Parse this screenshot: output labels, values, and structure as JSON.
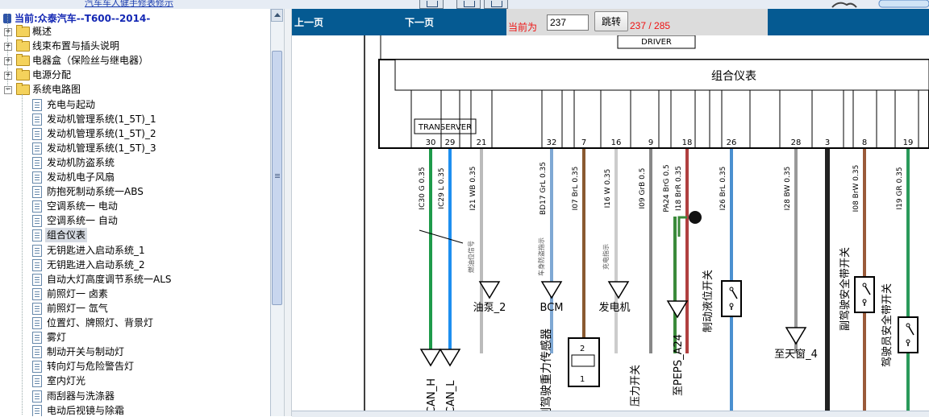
{
  "top": {
    "link_text": "汽车车人健手修表修示"
  },
  "tree": {
    "title": "当前:众泰汽车--T600--2014-",
    "nodes": [
      {
        "label": "概述",
        "kind": "folder",
        "expanded": false
      },
      {
        "label": "线束布置与插头说明",
        "kind": "folder",
        "expanded": false
      },
      {
        "label": "电器盒（保险丝与继电器）",
        "kind": "folder",
        "expanded": false
      },
      {
        "label": "电源分配",
        "kind": "folder",
        "expanded": false
      },
      {
        "label": "系统电路图",
        "kind": "folder",
        "expanded": true
      },
      {
        "label": "充电与起动",
        "kind": "doc"
      },
      {
        "label": "发动机管理系统(1_5T)_1",
        "kind": "doc"
      },
      {
        "label": "发动机管理系统(1_5T)_2",
        "kind": "doc"
      },
      {
        "label": "发动机管理系统(1_5T)_3",
        "kind": "doc"
      },
      {
        "label": "发动机防盗系统",
        "kind": "doc"
      },
      {
        "label": "发动机电子风扇",
        "kind": "doc"
      },
      {
        "label": "防抱死制动系统一ABS",
        "kind": "doc"
      },
      {
        "label": "空调系统一 电动",
        "kind": "doc"
      },
      {
        "label": "空调系统一 自动",
        "kind": "doc"
      },
      {
        "label": "组合仪表",
        "kind": "doc",
        "selected": true
      },
      {
        "label": "无钥匙进入启动系统_1",
        "kind": "doc"
      },
      {
        "label": "无钥匙进入启动系统_2",
        "kind": "doc"
      },
      {
        "label": "自动大灯高度调节系统一ALS",
        "kind": "doc"
      },
      {
        "label": "前照灯一 卤素",
        "kind": "doc"
      },
      {
        "label": "前照灯一 氙气",
        "kind": "doc"
      },
      {
        "label": "位置灯、牌照灯、背景灯",
        "kind": "doc"
      },
      {
        "label": "雾灯",
        "kind": "doc"
      },
      {
        "label": "制动开关与制动灯",
        "kind": "doc"
      },
      {
        "label": "转向灯与危险警告灯",
        "kind": "doc"
      },
      {
        "label": "室内灯光",
        "kind": "doc"
      },
      {
        "label": "雨刮器与洗涤器",
        "kind": "doc"
      },
      {
        "label": "电动后视镜与除霜",
        "kind": "doc"
      }
    ]
  },
  "toolbar": {
    "prev_label": "上一页",
    "next_label": "下一页",
    "current_label": "当前为",
    "page_value": "237",
    "jump_label": "跳转",
    "page_count": "237 / 285"
  },
  "diagram": {
    "driver_label": "DRIVER",
    "cluster_label": "组合仪表",
    "transerver_label": "TRANSERVER",
    "pins": [
      {
        "pin": "30",
        "wire": "IC30 G 0.35",
        "color": "#1e9a4a",
        "note": "",
        "dest": "CAN_H"
      },
      {
        "pin": "29",
        "wire": "IC29 L 0.35",
        "color": "#1e8ff0",
        "note": "",
        "dest": "CAN_L"
      },
      {
        "pin": "21",
        "wire": "I21 WB 0.35",
        "color": "#bbbbbb",
        "note": "燃油位信号",
        "dest": "油泵_2"
      },
      {
        "pin": "32",
        "wire": "BD17 GrL 0.35",
        "color": "#7fa8d4",
        "note": "车身防盗指示",
        "dest": "BCM"
      },
      {
        "pin": "7",
        "wire": "I07 BrL 0.35",
        "color": "#8a5a30",
        "note": "",
        "dest": "副驾驶重力传感器"
      },
      {
        "pin": "16",
        "wire": "I16 W 0.35",
        "color": "#cccccc",
        "note": "充电指示",
        "dest": "发电机"
      },
      {
        "pin": "9",
        "wire": "I09 GrB 0.5",
        "color": "#888888",
        "note": "",
        "dest": "压力开关"
      },
      {
        "pin": "18",
        "wire": "I18 BrR 0.35",
        "color": "#b04040",
        "note": "",
        "dest": "至PEPS_A24"
      },
      {
        "pin": "",
        "wire": "PA24 BrG 0.5",
        "color": "#3a8a3a",
        "note": "",
        "dest": ""
      },
      {
        "pin": "26",
        "wire": "I26 BrL 0.35",
        "color": "#4a90d0",
        "note": "",
        "dest": "制动液位开关"
      },
      {
        "pin": "28",
        "wire": "I28 BW 0.35",
        "color": "#999999",
        "note": "",
        "dest": "至天窗_4"
      },
      {
        "pin": "3",
        "wire": "",
        "color": "#222222",
        "note": "",
        "dest": ""
      },
      {
        "pin": "8",
        "wire": "I08 BrW 0.35",
        "color": "#9a5a3a",
        "note": "",
        "dest": "副驾驶安全带开关"
      },
      {
        "pin": "19",
        "wire": "I19 GR 0.35",
        "color": "#2a9a5a",
        "note": "",
        "dest": "驾驶员安全带开关"
      }
    ]
  }
}
